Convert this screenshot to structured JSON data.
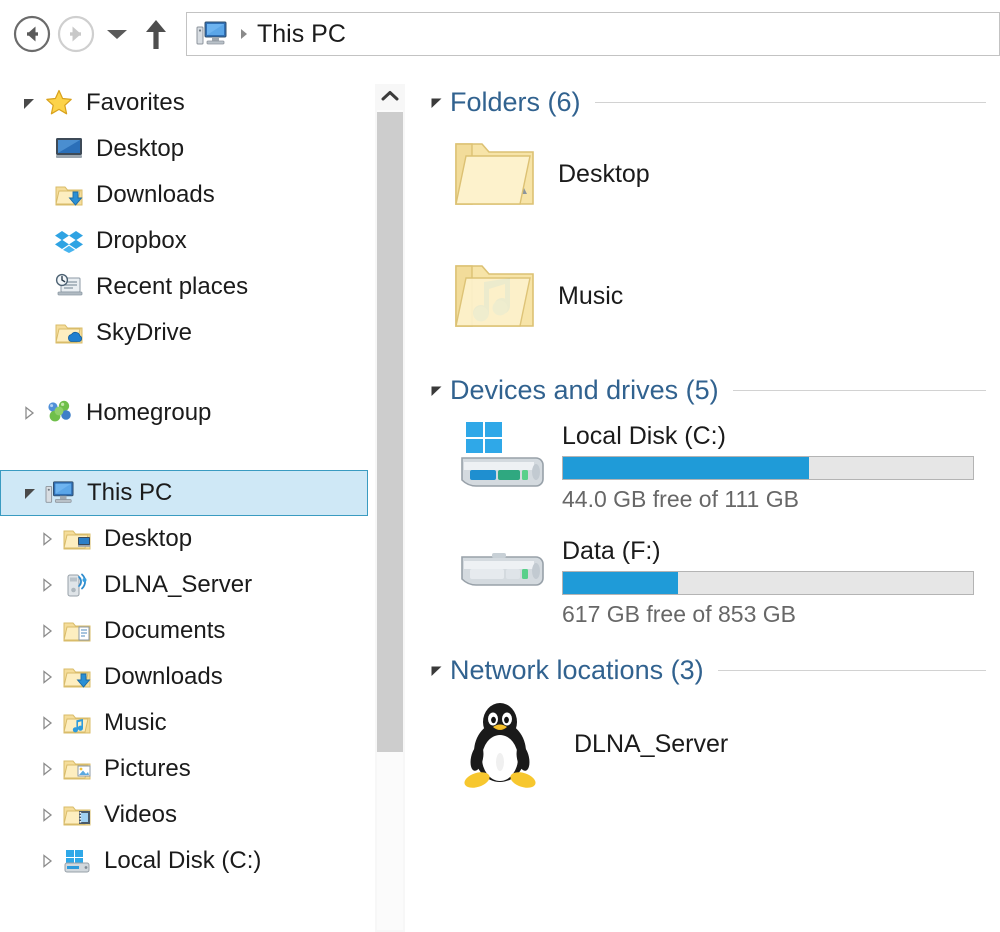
{
  "toolbar": {
    "back_label": "Back",
    "forward_label": "Forward",
    "recent_dropdown_label": "Recent locations",
    "up_label": "Up to parent folder",
    "back_icon": "arrow-left-circle-icon",
    "forward_icon": "arrow-right-circle-icon",
    "dropdown_icon": "chevron-down-icon",
    "up_icon": "arrow-up-icon"
  },
  "address_bar": {
    "icon": "this-pc-icon",
    "separator": "chevron-right-small",
    "path_text": "This PC"
  },
  "sidebar": {
    "groups": [
      {
        "name": "favorites",
        "header": {
          "label": "Favorites",
          "icon": "star-icon",
          "expanded": true,
          "twisty": "expanded-triangle"
        },
        "items": [
          {
            "label": "Desktop",
            "icon": "desktop-monitor-icon",
            "twisty": "none"
          },
          {
            "label": "Downloads",
            "icon": "folder-download-icon",
            "twisty": "none"
          },
          {
            "label": "Dropbox",
            "icon": "dropbox-icon",
            "twisty": "none"
          },
          {
            "label": "Recent places",
            "icon": "recent-places-icon",
            "twisty": "none"
          },
          {
            "label": "SkyDrive",
            "icon": "folder-cloud-icon",
            "twisty": "none"
          }
        ]
      },
      {
        "name": "homegroup",
        "header": {
          "label": "Homegroup",
          "icon": "homegroup-icon",
          "expanded": false,
          "twisty": "collapsed-triangle"
        },
        "items": []
      },
      {
        "name": "this-pc",
        "header": {
          "label": "This PC",
          "icon": "this-pc-icon",
          "expanded": true,
          "twisty": "expanded-triangle",
          "selected": true
        },
        "items": [
          {
            "label": "Desktop",
            "icon": "folder-desktop-icon",
            "twisty": "collapsed-triangle"
          },
          {
            "label": "DLNA_Server",
            "icon": "dlna-server-icon",
            "twisty": "collapsed-triangle"
          },
          {
            "label": "Documents",
            "icon": "folder-documents-icon",
            "twisty": "collapsed-triangle"
          },
          {
            "label": "Downloads",
            "icon": "folder-download-icon",
            "twisty": "collapsed-triangle"
          },
          {
            "label": "Music",
            "icon": "folder-music-icon",
            "twisty": "collapsed-triangle"
          },
          {
            "label": "Pictures",
            "icon": "folder-pictures-icon",
            "twisty": "collapsed-triangle"
          },
          {
            "label": "Videos",
            "icon": "folder-videos-icon",
            "twisty": "collapsed-triangle"
          },
          {
            "label": "Local Disk (C:)",
            "icon": "windows-drive-icon",
            "twisty": "collapsed-triangle"
          }
        ]
      }
    ]
  },
  "scrollbar": {
    "up_arrow_icon": "chevron-up-icon",
    "orientation": "vertical"
  },
  "content": {
    "sections": [
      {
        "id": "folders",
        "title": "Folders (6)",
        "count": 6,
        "items": [
          {
            "label": "Desktop",
            "icon": "folder-open-desktop-icon"
          },
          {
            "label": "Music",
            "icon": "folder-open-music-icon"
          }
        ]
      },
      {
        "id": "devices-and-drives",
        "title": "Devices and drives (5)",
        "count": 5,
        "drives": [
          {
            "label": "Local Disk (C:)",
            "icon": "windows-hard-drive-icon",
            "free_text": "44.0 GB free of 111 GB",
            "free_gb": 44.0,
            "total_gb": 111,
            "used_percent": 60,
            "bar_color": "#1f9bd8"
          },
          {
            "label": "Data (F:)",
            "icon": "hard-drive-icon",
            "free_text": "617 GB free of 853 GB",
            "free_gb": 617,
            "total_gb": 853,
            "used_percent": 28,
            "bar_color": "#1f9bd8"
          }
        ]
      },
      {
        "id": "network-locations",
        "title": "Network locations (3)",
        "count": 3,
        "items": [
          {
            "label": "DLNA_Server",
            "icon": "linux-penguin-icon"
          }
        ]
      }
    ]
  },
  "colors": {
    "group_header": "#31628f",
    "selection_fill": "#cfe8f6",
    "selection_border": "#3a9bc1",
    "bar_fill": "#1f9bd8",
    "bar_track": "#e6e6e6",
    "text_primary": "#1b1b1b",
    "text_muted": "#676767"
  }
}
